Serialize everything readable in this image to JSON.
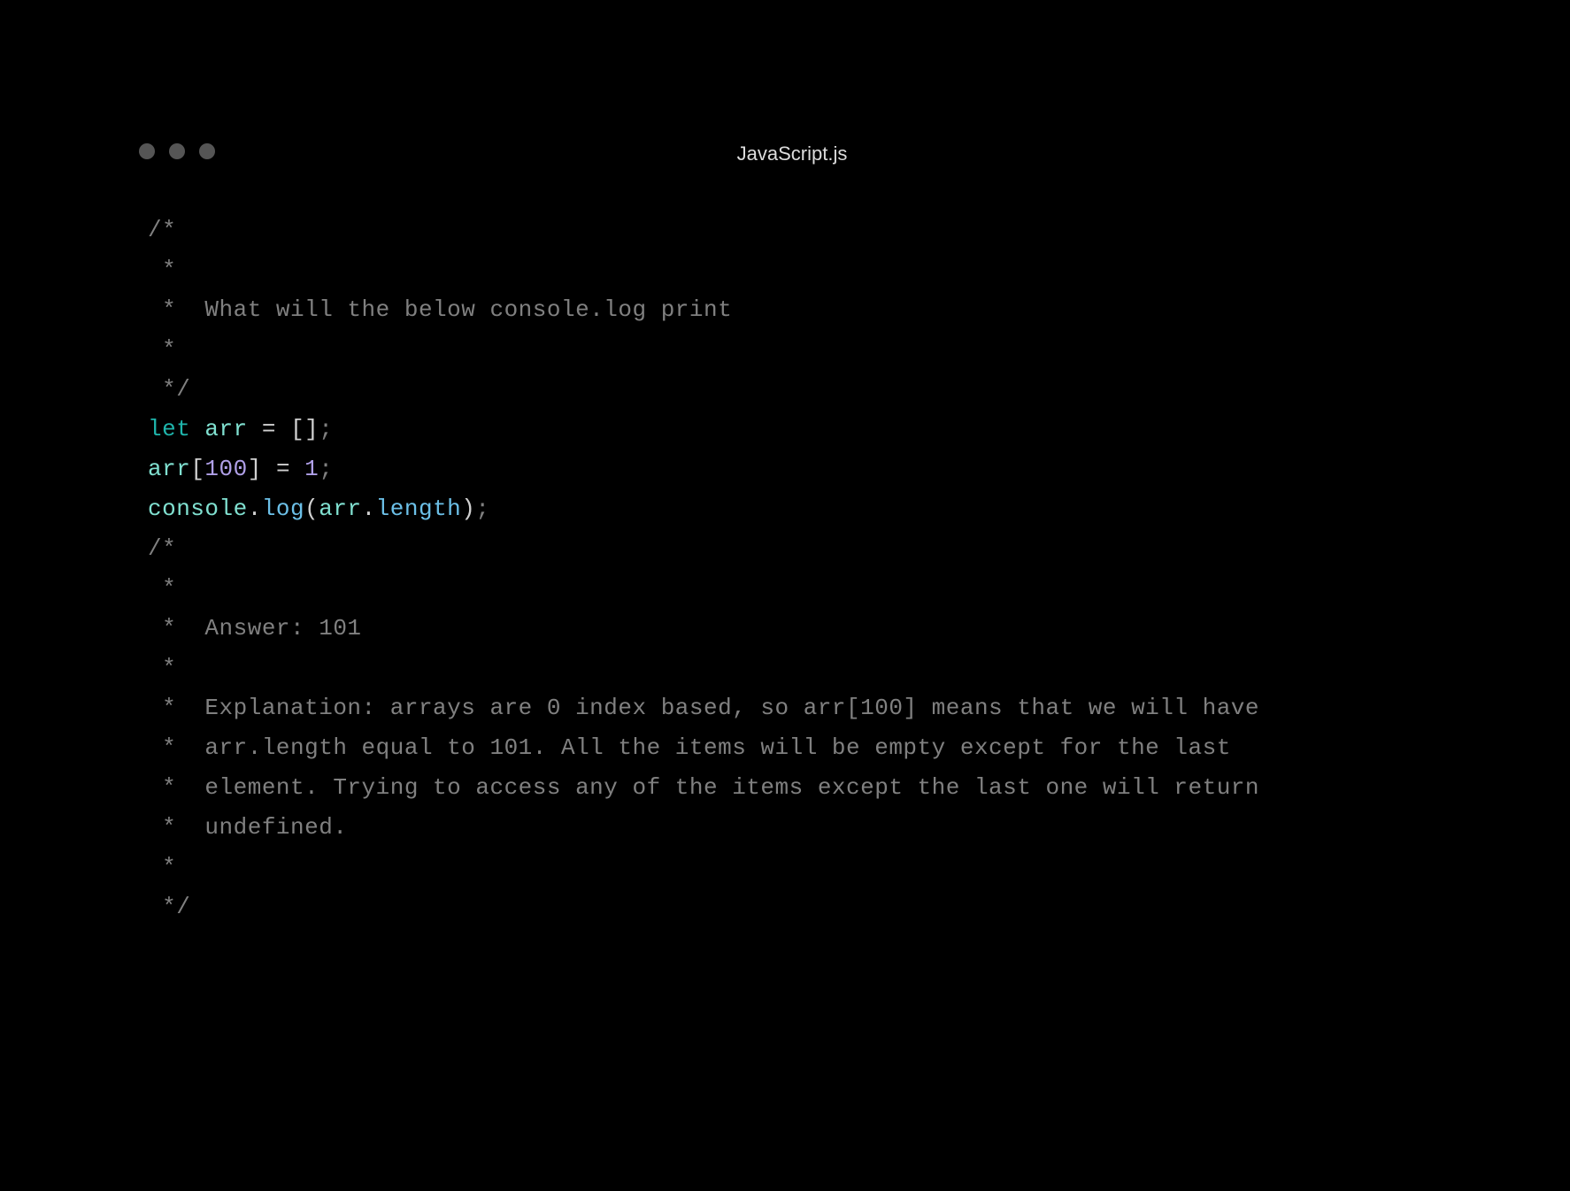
{
  "title": "JavaScript.js",
  "code": {
    "c1": "/*",
    "c2": " *",
    "c3": " *  What will the below console.log print",
    "c4": " *",
    "c5": " */",
    "blank1": "",
    "l1_let": "let",
    "l1_sp1": " ",
    "l1_arr": "arr",
    "l1_sp2": " ",
    "l1_eq": "=",
    "l1_sp3": " ",
    "l1_lb": "[",
    "l1_rb": "]",
    "l1_semi": ";",
    "l2_arr": "arr",
    "l2_lb": "[",
    "l2_num": "100",
    "l2_rb": "]",
    "l2_sp1": " ",
    "l2_eq": "=",
    "l2_sp2": " ",
    "l2_one": "1",
    "l2_semi": ";",
    "l3_console": "console",
    "l3_dot1": ".",
    "l3_log": "log",
    "l3_lp": "(",
    "l3_arr": "arr",
    "l3_dot2": ".",
    "l3_length": "length",
    "l3_rp": ")",
    "l3_semi": ";",
    "blank2": "",
    "c6": "/*",
    "c7": " *",
    "c8": " *  Answer: 101",
    "c9": " *",
    "c10": " *  Explanation: arrays are 0 index based, so arr[100] means that we will have",
    "c11": " *  arr.length equal to 101. All the items will be empty except for the last",
    "c12": " *  element. Trying to access any of the items except the last one will return",
    "c13": " *  undefined.",
    "c14": " *",
    "c15": " */"
  }
}
